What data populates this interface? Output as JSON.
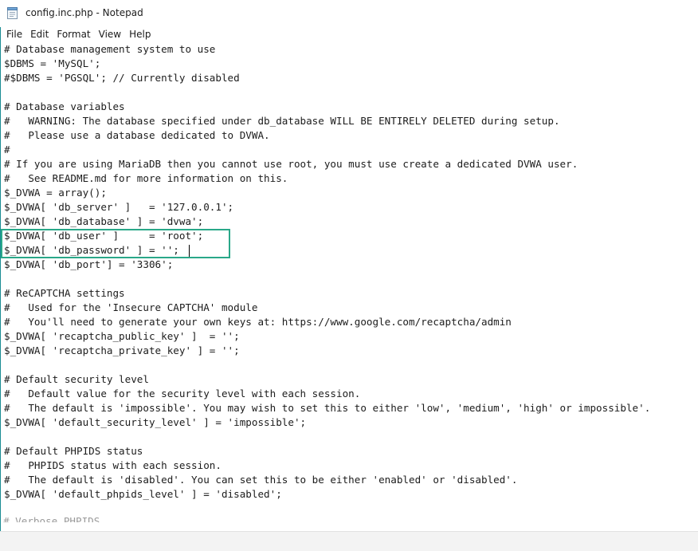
{
  "window": {
    "title": "config.inc.php - Notepad"
  },
  "menu": {
    "items": [
      "File",
      "Edit",
      "Format",
      "View",
      "Help"
    ]
  },
  "editor": {
    "lines": [
      "# Database management system to use",
      "$DBMS = 'MySQL';",
      "#$DBMS = 'PGSQL'; // Currently disabled",
      "",
      "# Database variables",
      "#   WARNING: The database specified under db_database WILL BE ENTIRELY DELETED during setup.",
      "#   Please use a database dedicated to DVWA.",
      "#",
      "# If you are using MariaDB then you cannot use root, you must use create a dedicated DVWA user.",
      "#   See README.md for more information on this.",
      "$_DVWA = array();",
      "$_DVWA[ 'db_server' ]   = '127.0.0.1';",
      "$_DVWA[ 'db_database' ] = 'dvwa';",
      "$_DVWA[ 'db_user' ]     = 'root';",
      "$_DVWA[ 'db_password' ] = '';",
      "$_DVWA[ 'db_port'] = '3306';",
      "",
      "# ReCAPTCHA settings",
      "#   Used for the 'Insecure CAPTCHA' module",
      "#   You'll need to generate your own keys at: https://www.google.com/recaptcha/admin",
      "$_DVWA[ 'recaptcha_public_key' ]  = '';",
      "$_DVWA[ 'recaptcha_private_key' ] = '';",
      "",
      "# Default security level",
      "#   Default value for the security level with each session.",
      "#   The default is 'impossible'. You may wish to set this to either 'low', 'medium', 'high' or impossible'.",
      "$_DVWA[ 'default_security_level' ] = 'impossible';",
      "",
      "# Default PHPIDS status",
      "#   PHPIDS status with each session.",
      "#   The default is 'disabled'. You can set this to be either 'enabled' or 'disabled'.",
      "$_DVWA[ 'default_phpids_level' ] = 'disabled';",
      ""
    ],
    "partial_line": "# Verbose PHPIDS"
  },
  "colors": {
    "highlight_border": "#2aa889",
    "window_accent": "#1a8c93"
  },
  "icons": {
    "app": "notepad-icon"
  }
}
